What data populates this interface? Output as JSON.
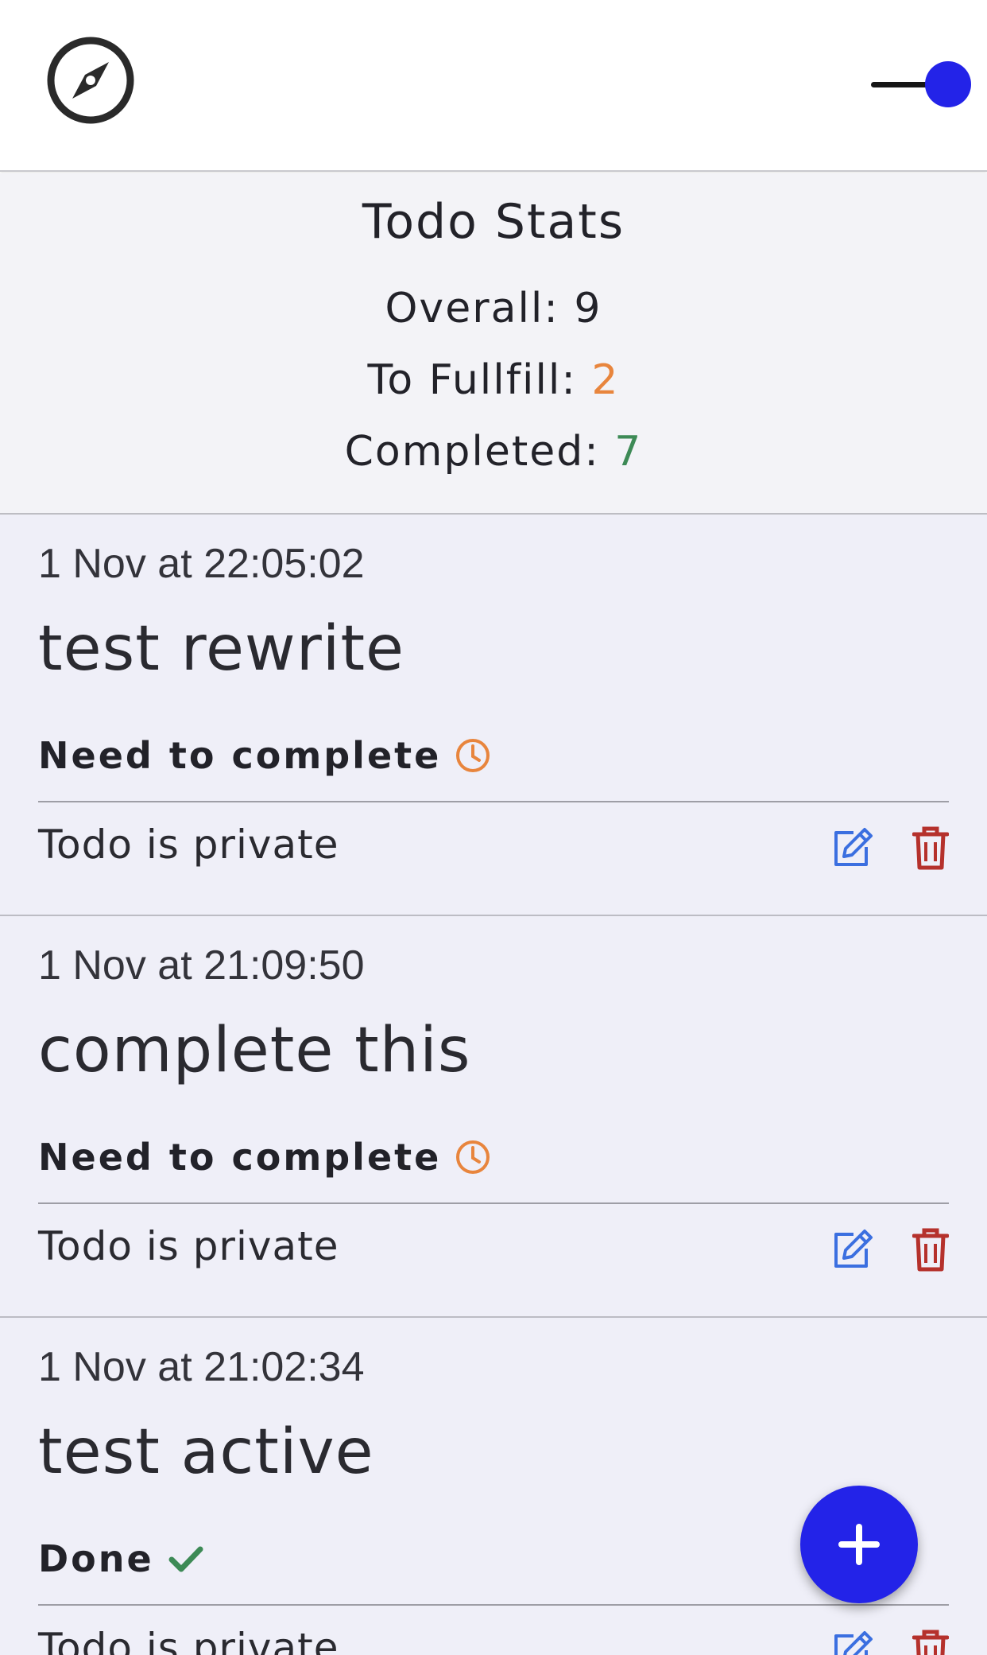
{
  "header": {
    "compass_icon": "compass-icon",
    "theme_toggle_on": true,
    "accent_color": "#2323e8"
  },
  "stats": {
    "title": "Todo Stats",
    "overall_label": "Overall:",
    "overall_value": "9",
    "to_fulfill_label": "To Fullfill:",
    "to_fulfill_value": "2",
    "completed_label": "Completed:",
    "completed_value": "7",
    "colors": {
      "pending": "#e8853d",
      "done": "#3d8a56"
    }
  },
  "todos": [
    {
      "date": "1 Nov at 22:05:02",
      "title": "test rewrite",
      "status": "Need to complete",
      "status_icon": "clock-icon",
      "privacy": "Todo is private"
    },
    {
      "date": "1 Nov at 21:09:50",
      "title": "complete this",
      "status": "Need to complete",
      "status_icon": "clock-icon",
      "privacy": "Todo is private"
    },
    {
      "date": "1 Nov at 21:02:34",
      "title": "test active",
      "status": "Done",
      "status_icon": "check-icon",
      "privacy": "Todo is private"
    }
  ],
  "actions": {
    "edit_icon": "edit-icon",
    "delete_icon": "trash-icon",
    "add_icon": "plus-icon",
    "edit_color": "#3b6fe0",
    "delete_color": "#b5312c"
  }
}
